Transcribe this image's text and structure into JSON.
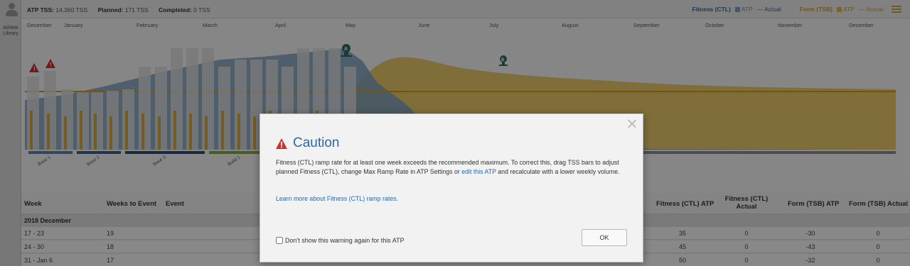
{
  "sidebar": {
    "library_label": "Athlete Library"
  },
  "topbar": {
    "atp_tss_label": "ATP TSS:",
    "atp_tss_value": "14,360 TSS",
    "planned_label": "Planned:",
    "planned_value": "171 TSS",
    "completed_label": "Completed:",
    "completed_value": "0 TSS",
    "legend": {
      "fitness": "Fitness (CTL)",
      "fitness_atp": "ATP",
      "fitness_actual": "— Actual",
      "form": "Form (TSB)",
      "form_atp": "ATP",
      "form_actual": "— Actual"
    }
  },
  "chart": {
    "months": [
      "December",
      "January",
      "February",
      "March",
      "April",
      "May",
      "June",
      "July",
      "August",
      "September",
      "October",
      "November",
      "December"
    ],
    "phases": [
      "Base 1",
      "Base 2",
      "Base 3",
      "Build 1"
    ],
    "colors": {
      "fitness": "#7d9dbd",
      "form": "#e2b63c",
      "bars": "#dcdcdc",
      "warning": "#c9302c"
    }
  },
  "table": {
    "headers": {
      "week": "Week",
      "weeks_to_event": "Weeks to Event",
      "event": "Event",
      "fitness_atp": "Fitness (CTL) ATP",
      "fitness_actual_1": "Fitness (CTL)",
      "fitness_actual_2": "Actual",
      "form_atp": "Form (TSB) ATP",
      "form_actual": "Form (TSB) Actual"
    },
    "section": "2018 December",
    "rows": [
      {
        "week": "17 - 23",
        "weeks_to_event": "19",
        "fitness_atp": "35",
        "fitness_actual": "0",
        "form_atp": "-30",
        "form_actual": "0"
      },
      {
        "week": "24 - 30",
        "weeks_to_event": "18",
        "fitness_atp": "45",
        "fitness_actual": "0",
        "form_atp": "-43",
        "form_actual": "0"
      },
      {
        "week": "31 - Jan 6",
        "weeks_to_event": "17",
        "fitness_atp": "50",
        "fitness_actual": "0",
        "form_atp": "-32",
        "form_actual": "0"
      }
    ]
  },
  "modal": {
    "title": "Caution",
    "body_before_link": "Fitness (CTL) ramp rate for at least one week exceeds the recommended maximum. To correct this, drag TSS bars to adjust planned Fitness (CTL), change Max Ramp Rate in ATP Settings or ",
    "body_link": "edit this ATP",
    "body_after_link": " and recalculate with a lower weekly volume.",
    "learn_more": "Learn more about Fitness (CTL) ramp rates.",
    "checkbox_label": "Don't show this warning again for this ATP",
    "ok_label": "OK"
  }
}
